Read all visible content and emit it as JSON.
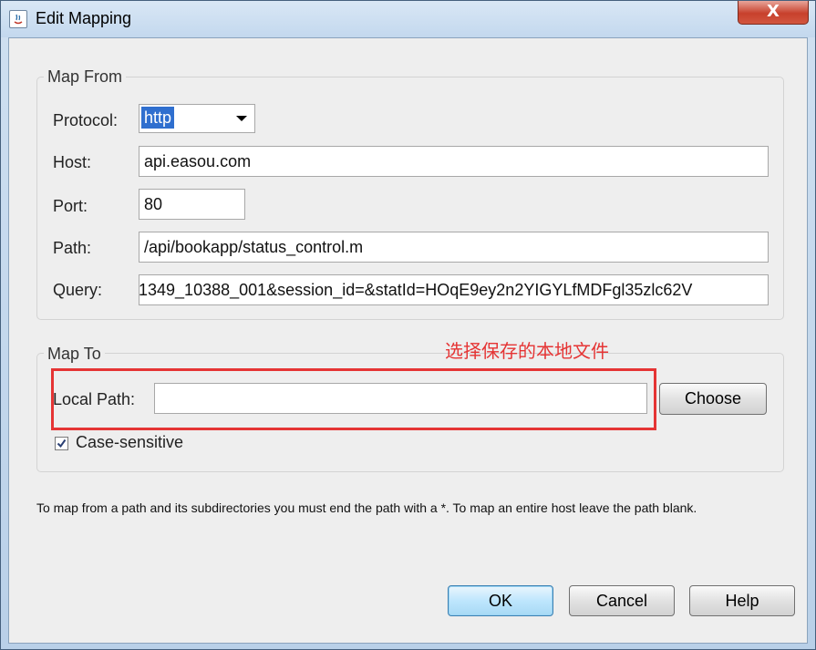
{
  "window": {
    "title": "Edit Mapping",
    "close_label": "X"
  },
  "map_from": {
    "legend": "Map From",
    "protocol_label": "Protocol:",
    "protocol_value": "http",
    "host_label": "Host:",
    "host_value": "api.easou.com",
    "port_label": "Port:",
    "port_value": "80",
    "path_label": "Path:",
    "path_value": "/api/bookapp/status_control.m",
    "query_label": "Query:",
    "query_value": "1349_10388_001&session_id=&statId=HOqE9ey2n2YIGYLfMDFgl35zlc62V"
  },
  "map_to": {
    "legend": "Map To",
    "annotation": "选择保存的本地文件",
    "local_path_label": "Local Path:",
    "local_path_value": "",
    "choose_label": "Choose",
    "case_sensitive_label": "Case-sensitive",
    "case_sensitive_checked": true
  },
  "note": "To map from a path and its subdirectories you must end the path with a *. To map an entire host leave the path blank.",
  "buttons": {
    "ok": "OK",
    "cancel": "Cancel",
    "help": "Help"
  },
  "colors": {
    "annotation": "#e53434",
    "selection": "#2f6fcf"
  }
}
